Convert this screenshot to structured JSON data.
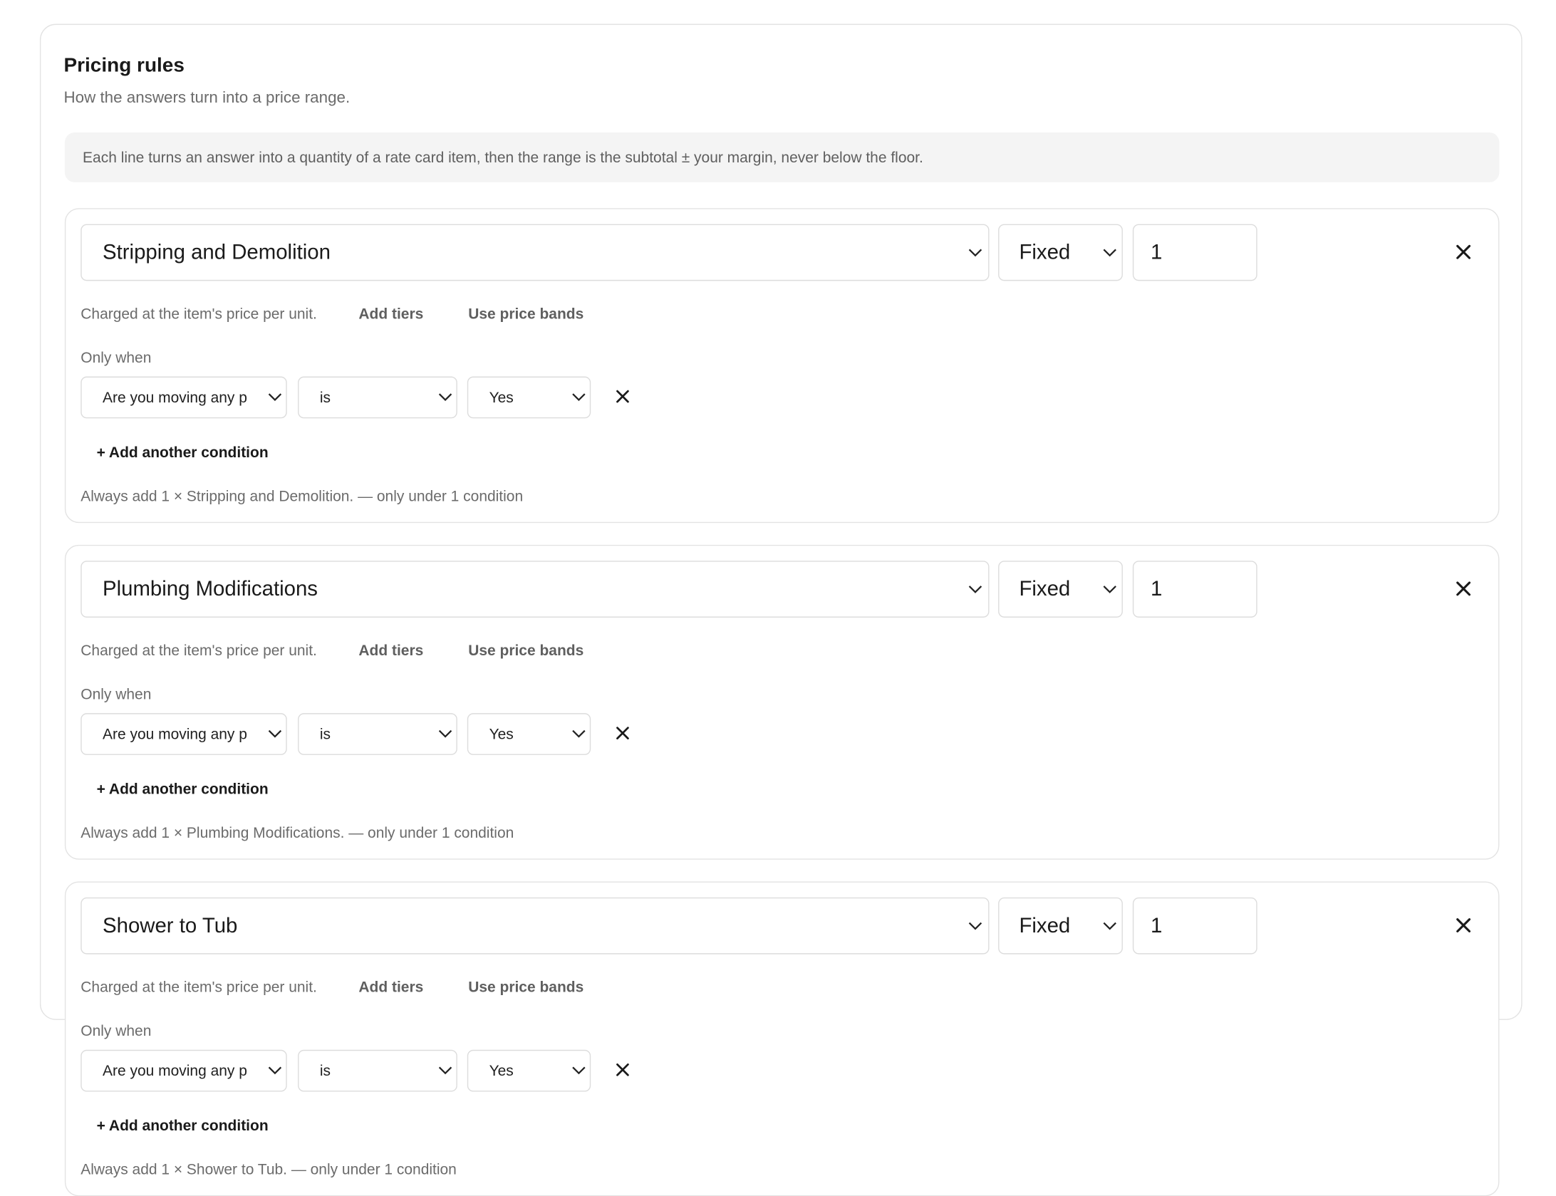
{
  "panel": {
    "title": "Pricing rules",
    "subtitle": "How the answers turn into a price range.",
    "note": "Each line turns an answer into a quantity of a rate card item, then the range is the subtotal ± your margin, never below the floor."
  },
  "icons": {
    "dropdown": "chevron-down-icon",
    "remove": "close-icon"
  },
  "rules": [
    {
      "item": "Stripping and Demolition",
      "mode": "Fixed",
      "quantity": "1",
      "charged_text": "Charged at the item's price per unit.",
      "add_tiers": "Add tiers",
      "use_price_bands": "Use price bands",
      "only_when": "Only when",
      "condition": {
        "question": "Are you moving any p",
        "operator": "is",
        "value": "Yes"
      },
      "add_condition": "+ Add another condition",
      "summary": "Always add 1 × Stripping and Demolition. — only under 1 condition"
    },
    {
      "item": "Plumbing Modifications",
      "mode": "Fixed",
      "quantity": "1",
      "charged_text": "Charged at the item's price per unit.",
      "add_tiers": "Add tiers",
      "use_price_bands": "Use price bands",
      "only_when": "Only when",
      "condition": {
        "question": "Are you moving any p",
        "operator": "is",
        "value": "Yes"
      },
      "add_condition": "+ Add another condition",
      "summary": "Always add 1 × Plumbing Modifications. — only under 1 condition"
    },
    {
      "item": "Shower to Tub",
      "mode": "Fixed",
      "quantity": "1",
      "charged_text": "Charged at the item's price per unit.",
      "add_tiers": "Add tiers",
      "use_price_bands": "Use price bands",
      "only_when": "Only when",
      "condition": {
        "question": "Are you moving any p",
        "operator": "is",
        "value": "Yes"
      },
      "add_condition": "+ Add another condition",
      "summary": "Always add 1 × Shower to Tub. — only under 1 condition"
    }
  ]
}
